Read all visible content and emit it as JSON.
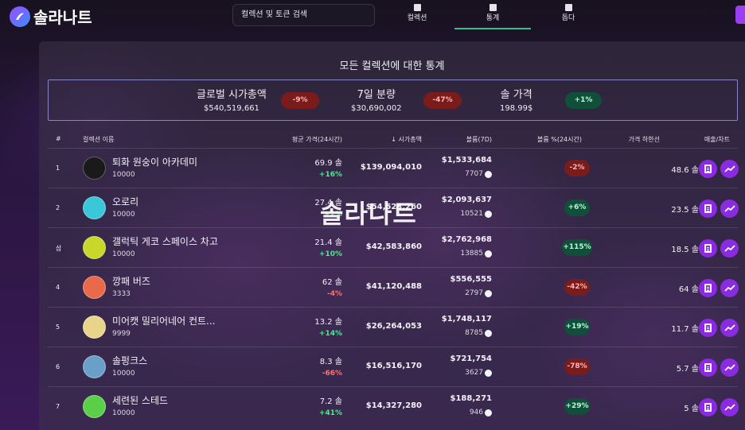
{
  "app": {
    "name": "솔라나트",
    "watermark": "솔라나트"
  },
  "search": {
    "placeholder": "컬렉션 및 토큰 검색"
  },
  "nav": [
    {
      "label": "컬렉션",
      "icon": "image-icon"
    },
    {
      "label": "통계",
      "icon": "chart-icon",
      "active": true
    },
    {
      "label": "돕다",
      "icon": "help-icon"
    }
  ],
  "page": {
    "title": "모든 컬렉션에 대한 통계"
  },
  "summary": {
    "market_cap": {
      "label": "글로벌 시가총액",
      "value": "$540,519,661",
      "change": "-9%"
    },
    "volume_7d": {
      "label": "7일 분량",
      "value": "$30,690,002",
      "change": "-47%"
    },
    "sol_price": {
      "label": "솔 가격",
      "value": "198.99$",
      "change": "+1%"
    }
  },
  "table": {
    "headers": {
      "rank": "#",
      "name": "컬렉션 이름",
      "avg_price": "평균 가격(24시간)",
      "market_cap": "↓ 시가총액",
      "volume": "볼륨(7D)",
      "volume_pct": "볼륨 %(24시간)",
      "floor": "가격 하한선",
      "actions": "매출/차트"
    },
    "rows": [
      {
        "rank": "1",
        "name": "퇴화 원숭이 아카데미",
        "supply": "10000",
        "price": "69.9 솔",
        "price_change": "+16%",
        "price_dir": "up",
        "market_cap": "$139,094,010",
        "volume": "$1,533,684",
        "volume_sol": "7707",
        "volume_pct": "-2%",
        "volume_dir": "neg",
        "floor": "48.6 솔",
        "avatar_color": "#1a1a1a"
      },
      {
        "rank": "2",
        "name": "오로리",
        "supply": "10000",
        "price": "27.4 솔",
        "price_change": "+2%",
        "price_dir": "up",
        "market_cap": "$54,523,260",
        "volume": "$2,093,637",
        "volume_sol": "10521",
        "volume_pct": "+6%",
        "volume_dir": "pos",
        "floor": "23.5 솔",
        "avatar_color": "#3ac7d9"
      },
      {
        "rank": "삼",
        "name": "갤럭틱 게코 스페이스 차고",
        "supply": "10000",
        "price": "21.4 솔",
        "price_change": "+10%",
        "price_dir": "up",
        "market_cap": "$42,583,860",
        "volume": "$2,762,968",
        "volume_sol": "13885",
        "volume_pct": "+115%",
        "volume_dir": "pos",
        "floor": "18.5 솔",
        "avatar_color": "#c9d62a"
      },
      {
        "rank": "4",
        "name": "깡패 버즈",
        "supply": "3333",
        "price": "62 솔",
        "price_change": "-4%",
        "price_dir": "down",
        "market_cap": "$41,120,488",
        "volume": "$556,555",
        "volume_sol": "2797",
        "volume_pct": "-42%",
        "volume_dir": "neg",
        "floor": "64 솔",
        "avatar_color": "#e86a4a"
      },
      {
        "rank": "5",
        "name": "미어캣 밀리어네어 컨트...",
        "supply": "9999",
        "price": "13.2 솔",
        "price_change": "+14%",
        "price_dir": "up",
        "market_cap": "$26,264,053",
        "volume": "$1,748,117",
        "volume_sol": "8785",
        "volume_pct": "+19%",
        "volume_dir": "pos",
        "floor": "11.7 솔",
        "avatar_color": "#e8d48a"
      },
      {
        "rank": "6",
        "name": "솔펑크스",
        "supply": "10000",
        "price": "8.3 솔",
        "price_change": "-66%",
        "price_dir": "down",
        "market_cap": "$16,516,170",
        "volume": "$721,754",
        "volume_sol": "3627",
        "volume_pct": "-78%",
        "volume_dir": "neg",
        "floor": "5.7 솔",
        "avatar_color": "#6aa0c8"
      },
      {
        "rank": "7",
        "name": "세련된 스테드",
        "supply": "10000",
        "price": "7.2 솔",
        "price_change": "+41%",
        "price_dir": "up",
        "market_cap": "$14,327,280",
        "volume": "$188,271",
        "volume_sol": "946",
        "volume_pct": "+29%",
        "volume_dir": "pos",
        "floor": "5 솔",
        "avatar_color": "#5ccf4a"
      }
    ]
  },
  "colors": {
    "accent": "#8a2be2",
    "positive": "#4ee88f",
    "negative": "#ff7070",
    "active_tab": "#2fbf8f"
  }
}
